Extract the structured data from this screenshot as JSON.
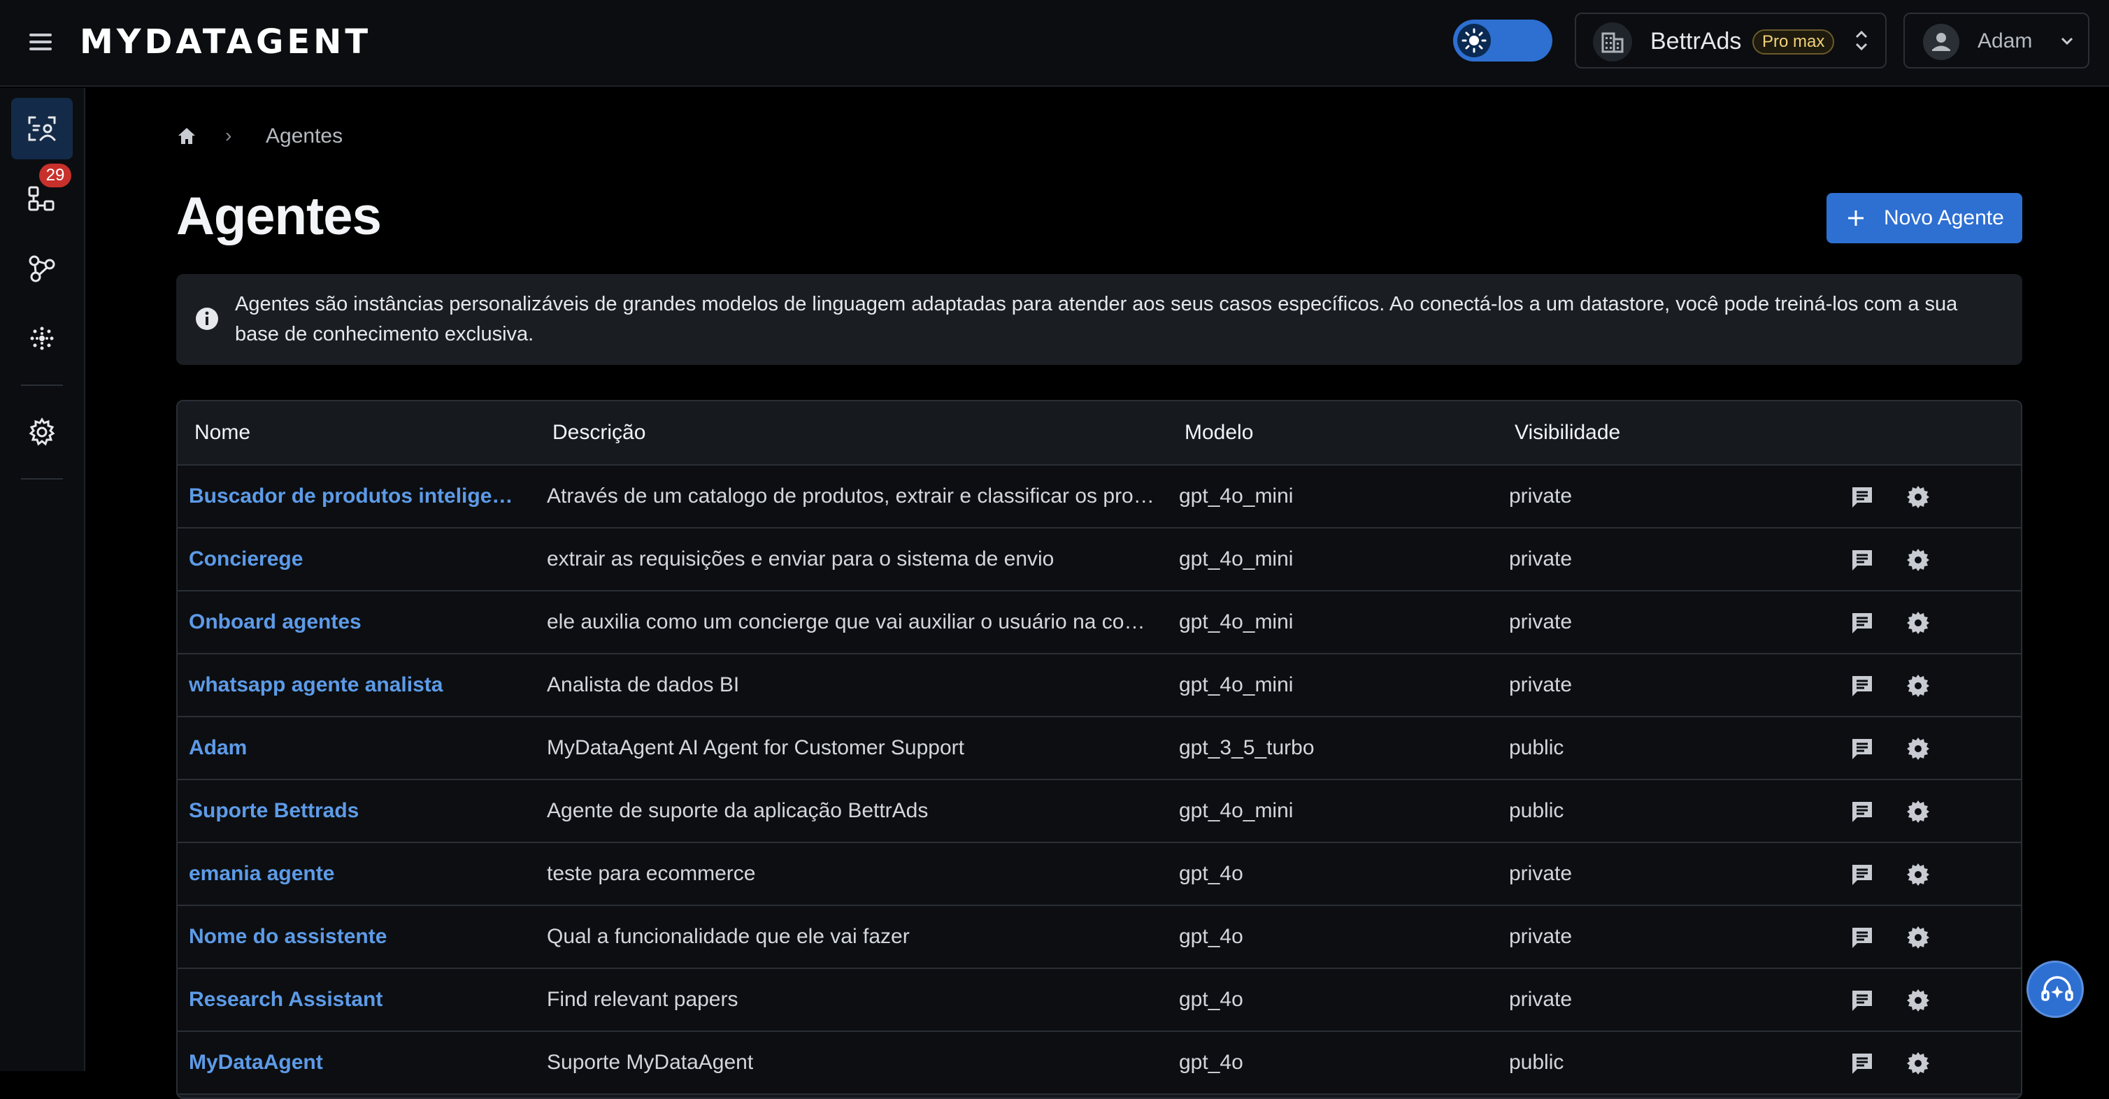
{
  "app": {
    "logo_text": "MYDATAGENT"
  },
  "header": {
    "org_name": "BettrAds",
    "plan_badge": "Pro max",
    "user_name": "Adam"
  },
  "sidebar": {
    "items": [
      {
        "name": "agents",
        "icon": "agent-icon",
        "active": true
      },
      {
        "name": "datastores",
        "icon": "datastore-icon",
        "badge": "29"
      },
      {
        "name": "integrations",
        "icon": "integrations-icon"
      },
      {
        "name": "ai-tools",
        "icon": "ai-icon"
      },
      {
        "name": "settings",
        "icon": "gear-icon"
      }
    ]
  },
  "breadcrumb": {
    "current": "Agentes"
  },
  "page": {
    "title": "Agentes",
    "new_button": "Novo Agente",
    "info": "Agentes são instâncias personalizáveis de grandes modelos de linguagem adaptadas para atender aos seus casos específicos. Ao conectá-los a um datastore, você pode treiná-los com a sua base de conhecimento exclusiva."
  },
  "table": {
    "headers": [
      "Nome",
      "Descrição",
      "Modelo",
      "Visibilidade"
    ],
    "rows": [
      {
        "name": "Buscador de produtos inteligentes",
        "desc": "Através de um catalogo de produtos, extrair e classificar os produto...",
        "model": "gpt_4o_mini",
        "vis": "private"
      },
      {
        "name": "Concierege",
        "desc": "extrair as requisições e enviar para o sistema de envio",
        "model": "gpt_4o_mini",
        "vis": "private"
      },
      {
        "name": "Onboard agentes",
        "desc": "ele auxilia como um concierge que vai auxiliar o usuário na construç...",
        "model": "gpt_4o_mini",
        "vis": "private"
      },
      {
        "name": "whatsapp agente analista",
        "desc": "Analista de dados BI",
        "model": "gpt_4o_mini",
        "vis": "private"
      },
      {
        "name": "Adam",
        "desc": "MyDataAgent AI Agent for Customer Support",
        "model": "gpt_3_5_turbo",
        "vis": "public"
      },
      {
        "name": "Suporte Bettrads",
        "desc": "Agente de suporte da aplicação BettrAds",
        "model": "gpt_4o_mini",
        "vis": "public"
      },
      {
        "name": "emania agente",
        "desc": "teste para ecommerce",
        "model": "gpt_4o",
        "vis": "private"
      },
      {
        "name": "Nome do assistente",
        "desc": "Qual a funcionalidade que ele vai fazer",
        "model": "gpt_4o",
        "vis": "private"
      },
      {
        "name": "Research Assistant",
        "desc": "Find relevant papers",
        "model": "gpt_4o",
        "vis": "private"
      },
      {
        "name": "MyDataAgent",
        "desc": "Suporte MyDataAgent",
        "model": "gpt_4o",
        "vis": "public"
      }
    ]
  },
  "colors": {
    "accent": "#2e6fd2",
    "link": "#5d9be8",
    "badge": "#c7302b"
  }
}
